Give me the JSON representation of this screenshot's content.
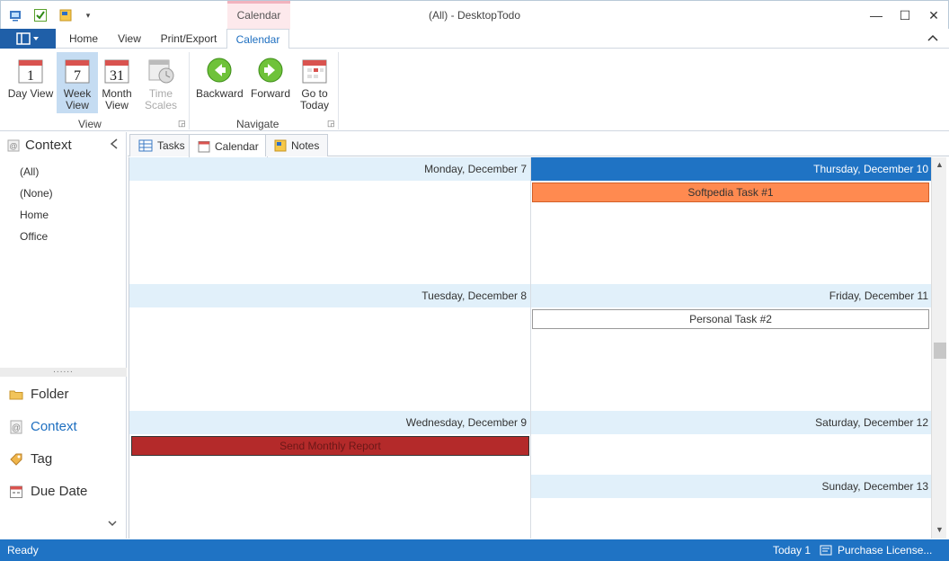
{
  "window": {
    "title": "(All) - DesktopTodo",
    "contextual_tab_group": "Calendar",
    "minimize": "—",
    "maximize": "☐",
    "close": "✕"
  },
  "ribbon_tabs": [
    "Home",
    "View",
    "Print/Export",
    "Calendar"
  ],
  "ribbon": {
    "view_group": {
      "label": "View",
      "day_view": [
        "Day View",
        ""
      ],
      "week_view": [
        "Week",
        "View"
      ],
      "month_view": [
        "Month",
        "View"
      ],
      "time_scales": [
        "Time",
        "Scales"
      ]
    },
    "navigate_group": {
      "label": "Navigate",
      "backward": "Backward",
      "forward": "Forward",
      "go_to_today": [
        "Go to",
        "Today"
      ]
    },
    "calendar_icon_numbers": {
      "day": "1",
      "week": "7",
      "month": "31"
    }
  },
  "left_pane": {
    "header": "Context",
    "contexts": [
      "(All)",
      "(None)",
      "Home",
      "Office"
    ],
    "splitter_grip": "......",
    "nav": {
      "folder": "Folder",
      "context": "Context",
      "tag": "Tag",
      "due_date": "Due Date"
    }
  },
  "doc_tabs": {
    "tasks": "Tasks",
    "calendar": "Calendar",
    "notes": "Notes"
  },
  "calendar": {
    "days": {
      "mon": "Monday, December 7",
      "tue": "Tuesday, December 8",
      "wed": "Wednesday, December 9",
      "thu": "Thursday, December 10",
      "fri": "Friday, December 11",
      "sat": "Saturday, December 12",
      "sun": "Sunday, December 13"
    },
    "today_day": "Thursday, December 10",
    "appointments": {
      "thu": "Softpedia Task #1",
      "fri": "Personal Task #2",
      "wed": "Send Monthly Report"
    },
    "colors": {
      "today_header": "#1f73c4",
      "day_header": "#e1f0fa",
      "softpedia_task": "#ff8a50",
      "personal_task": "#ffffff",
      "monthly_report": "#b42a2a"
    }
  },
  "status": {
    "ready": "Ready",
    "today": "Today 1",
    "purchase": "Purchase License..."
  },
  "icons": {
    "app": "app-icon",
    "qat_check": "check-icon",
    "qat_note": "note-icon",
    "qat_dropdown": "▾",
    "collapse_ribbon": "^",
    "collapse_pane": "<",
    "nav_more": "⌄",
    "sb_up": "▲",
    "sb_down": "▼"
  }
}
